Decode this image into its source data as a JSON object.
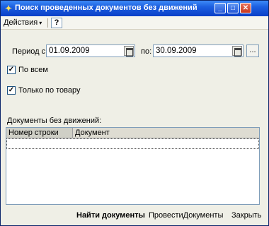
{
  "window": {
    "title": "Поиск проведенных документов без движений",
    "controls": {
      "minimize": "_",
      "maximize": "□",
      "close": "✕"
    }
  },
  "toolbar": {
    "actions_label": "Действия",
    "actions_caret": "▾",
    "help_label": "?"
  },
  "period": {
    "from_label": "Период с:",
    "from_value": "01.09.2009",
    "to_label": "по:",
    "to_value": "30.09.2009",
    "more_label": "..."
  },
  "options": {
    "all_label": "По всем",
    "all_checked": true,
    "goods_only_label": "Только по товару",
    "goods_only_checked": true,
    "check_mark": "✓"
  },
  "documents": {
    "section_label": "Документы без движений:",
    "columns": [
      "Номер строки",
      "Документ"
    ]
  },
  "buttons": {
    "find": "Найти документы",
    "post": "ПровестиДокументы",
    "close": "Закрыть"
  }
}
